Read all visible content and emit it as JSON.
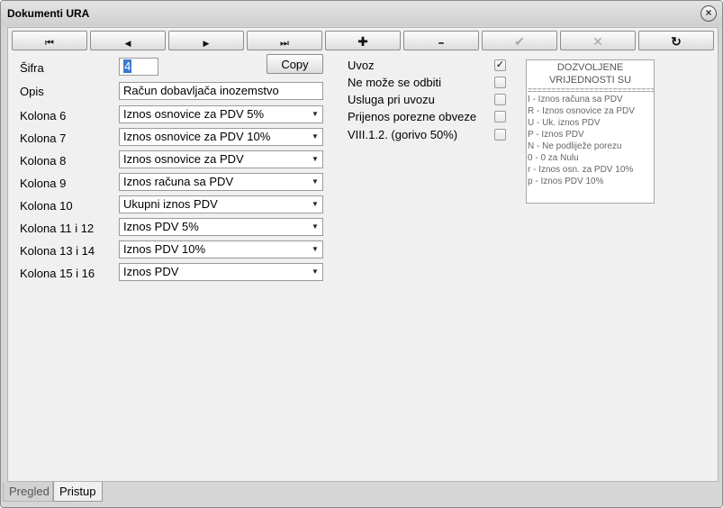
{
  "window": {
    "title": "Dokumenti URA",
    "close_label": "×"
  },
  "toolbar": {
    "buttons": [
      {
        "icon": "first-record-icon",
        "glyph": "⏮"
      },
      {
        "icon": "previous-record-icon",
        "glyph": "◀"
      },
      {
        "icon": "next-record-icon",
        "glyph": "▶"
      },
      {
        "icon": "last-record-icon",
        "glyph": "⏭"
      },
      {
        "icon": "add-icon",
        "glyph": "✚"
      },
      {
        "icon": "remove-icon",
        "glyph": "━"
      },
      {
        "icon": "confirm-icon",
        "glyph": "✔"
      },
      {
        "icon": "cancel-icon",
        "glyph": "✕"
      },
      {
        "icon": "refresh-icon",
        "glyph": "↻"
      }
    ]
  },
  "form": {
    "sifra": {
      "label": "Šifra",
      "value": "4"
    },
    "copy_label": "Copy",
    "opis": {
      "label": "Opis",
      "value": "Račun dobavljača inozemstvo"
    },
    "kolone": [
      {
        "label": "Kolona 6",
        "value": "Iznos osnovice za PDV 5%"
      },
      {
        "label": "Kolona 7",
        "value": "Iznos osnovice za PDV 10%"
      },
      {
        "label": "Kolona 8",
        "value": "Iznos osnovice za PDV"
      },
      {
        "label": "Kolona 9",
        "value": "Iznos računa sa PDV"
      },
      {
        "label": "Kolona 10",
        "value": "Ukupni iznos PDV"
      },
      {
        "label": "Kolona 11 i 12",
        "value": "Iznos PDV 5%"
      },
      {
        "label": "Kolona 13 i 14",
        "value": "Iznos PDV 10%"
      },
      {
        "label": "Kolona 15 i 16",
        "value": "Iznos PDV"
      }
    ]
  },
  "checkboxes": [
    {
      "label": "Uvoz",
      "checked": true,
      "mark": "✓"
    },
    {
      "label": "Ne može se odbiti",
      "checked": false,
      "mark": ""
    },
    {
      "label": "Usluga pri uvozu",
      "checked": false,
      "mark": ""
    },
    {
      "label": "Prijenos porezne obveze",
      "checked": false,
      "mark": ""
    },
    {
      "label": "VIII.1.2. (gorivo 50%)",
      "checked": false,
      "mark": ""
    }
  ],
  "info": {
    "heading_1": "DOZVOLJENE",
    "heading_2": "VRIJEDNOSTI SU",
    "separator": "===================================",
    "lines": [
      "I   - Iznos računa sa PDV",
      "R - Iznos osnovice za PDV",
      "U - Uk. iznos PDV",
      "P - Iznos PDV",
      "N - Ne podliježe porezu",
      "0 - 0 za Nulu",
      "r - Iznos osn. za PDV 10%",
      "p - Iznos PDV 10%"
    ]
  },
  "tabs": [
    {
      "label": "Pregled",
      "active": false
    },
    {
      "label": "Pristup",
      "active": true
    }
  ]
}
